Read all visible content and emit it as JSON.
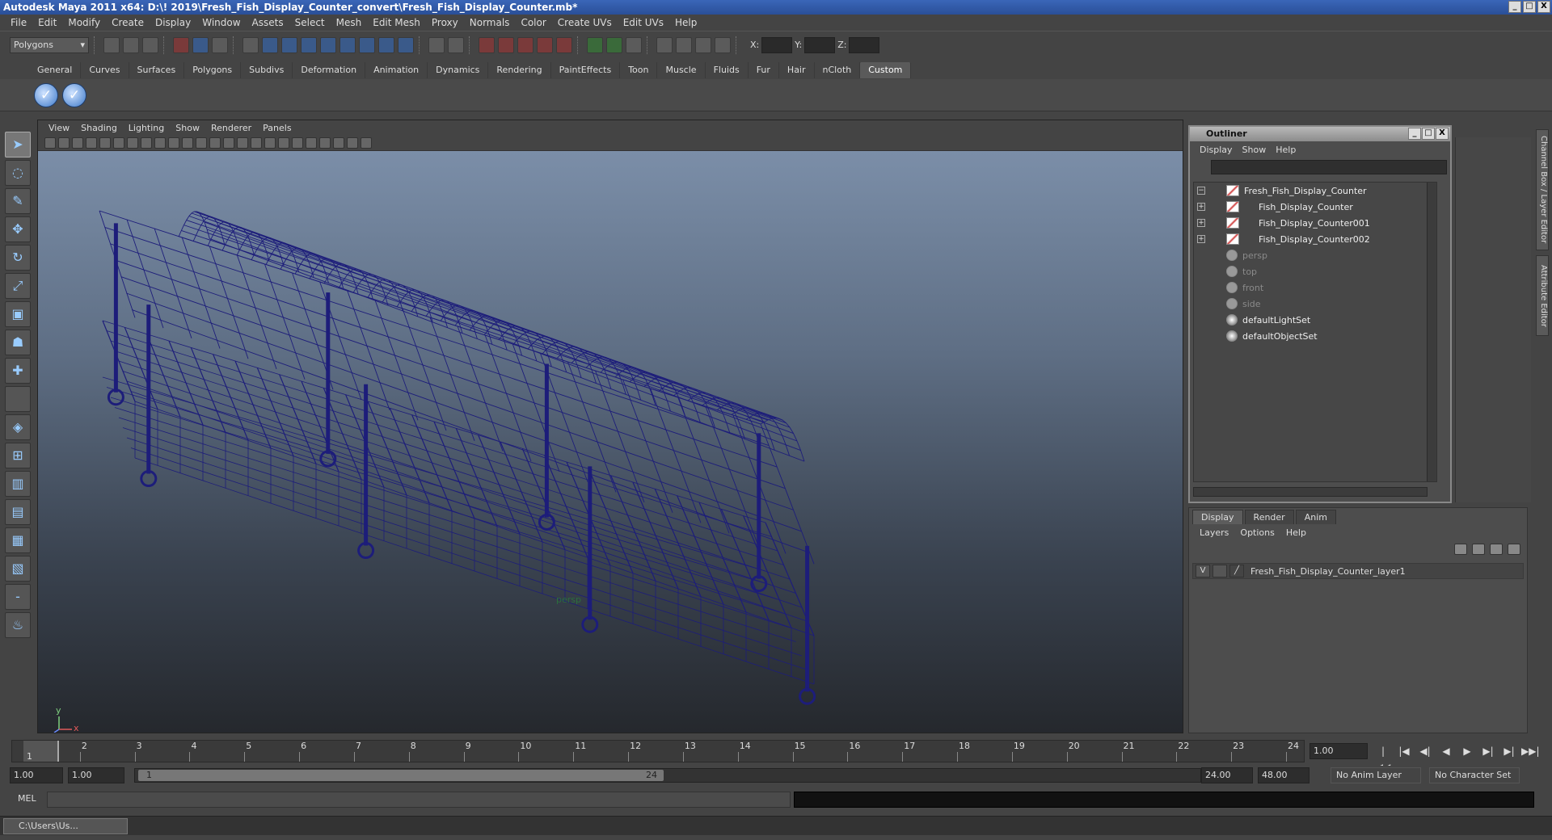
{
  "window": {
    "title": "Autodesk Maya 2011 x64: D:\\! 2019\\Fresh_Fish_Display_Counter_convert\\Fresh_Fish_Display_Counter.mb*",
    "min": "_",
    "max": "□",
    "close": "X"
  },
  "menubar": [
    "File",
    "Edit",
    "Modify",
    "Create",
    "Display",
    "Window",
    "Assets",
    "Select",
    "Mesh",
    "Edit Mesh",
    "Proxy",
    "Normals",
    "Color",
    "Create UVs",
    "Edit UVs",
    "Help"
  ],
  "statusline": {
    "mode": "Polygons",
    "x_label": "X:",
    "y_label": "Y:",
    "z_label": "Z:"
  },
  "shelf": {
    "tabs": [
      "General",
      "Curves",
      "Surfaces",
      "Polygons",
      "Subdivs",
      "Deformation",
      "Animation",
      "Dynamics",
      "Rendering",
      "PaintEffects",
      "Toon",
      "Muscle",
      "Fluids",
      "Fur",
      "Hair",
      "nCloth",
      "Custom"
    ],
    "active_tab": "Custom",
    "buttons": [
      "✓",
      "✓"
    ]
  },
  "viewport": {
    "menu": [
      "View",
      "Shading",
      "Lighting",
      "Show",
      "Renderer",
      "Panels"
    ],
    "camera_label": "persp",
    "axis_y": "y",
    "axis_x": "x",
    "wire_color": "#1d1d7a"
  },
  "outliner": {
    "title": "Outliner",
    "menu": [
      "Display",
      "Show",
      "Help"
    ],
    "items": [
      {
        "label": "Fresh_Fish_Display_Counter",
        "type": "mesh",
        "expand": "−",
        "child": false,
        "dim": false
      },
      {
        "label": "Fish_Display_Counter",
        "type": "mesh",
        "expand": "+",
        "child": true,
        "dim": false
      },
      {
        "label": "Fish_Display_Counter001",
        "type": "mesh",
        "expand": "+",
        "child": true,
        "dim": false
      },
      {
        "label": "Fish_Display_Counter002",
        "type": "mesh",
        "expand": "+",
        "child": true,
        "dim": false
      },
      {
        "label": "persp",
        "type": "cam",
        "expand": "",
        "child": false,
        "dim": true
      },
      {
        "label": "top",
        "type": "cam",
        "expand": "",
        "child": false,
        "dim": true
      },
      {
        "label": "front",
        "type": "cam",
        "expand": "",
        "child": false,
        "dim": true
      },
      {
        "label": "side",
        "type": "cam",
        "expand": "",
        "child": false,
        "dim": true
      },
      {
        "label": "defaultLightSet",
        "type": "set",
        "expand": "",
        "child": false,
        "dim": false
      },
      {
        "label": "defaultObjectSet",
        "type": "set",
        "expand": "",
        "child": false,
        "dim": false
      }
    ]
  },
  "side_tabs": {
    "channel_box": "Channel Box / Layer Editor",
    "attribute_editor": "Attribute Editor"
  },
  "layer_editor": {
    "tabs": [
      "Display",
      "Render",
      "Anim"
    ],
    "active_tab": "Display",
    "menu": [
      "Layers",
      "Options",
      "Help"
    ],
    "layer": {
      "visible": "V",
      "name": "Fresh_Fish_Display_Counter_layer1"
    }
  },
  "timeline": {
    "ticks": [
      "1",
      "2",
      "3",
      "4",
      "5",
      "6",
      "7",
      "8",
      "9",
      "10",
      "11",
      "12",
      "13",
      "14",
      "15",
      "16",
      "17",
      "18",
      "19",
      "20",
      "21",
      "22",
      "23",
      "24"
    ],
    "current_marker": "1",
    "current_frame": "1.00",
    "playback": [
      "|◀◀",
      "|◀",
      "◀|",
      "◀",
      "▶",
      "▶|",
      "▶|",
      "▶▶|"
    ]
  },
  "range": {
    "start": "1.00",
    "playback_start": "1.00",
    "bar_start": "1",
    "bar_end": "24",
    "playback_end": "24.00",
    "end": "48.00",
    "anim_layer": "No Anim Layer",
    "character_set": "No Character Set"
  },
  "cmdline": {
    "label": "MEL"
  },
  "taskbar": {
    "item": "C:\\Users\\Us..."
  }
}
